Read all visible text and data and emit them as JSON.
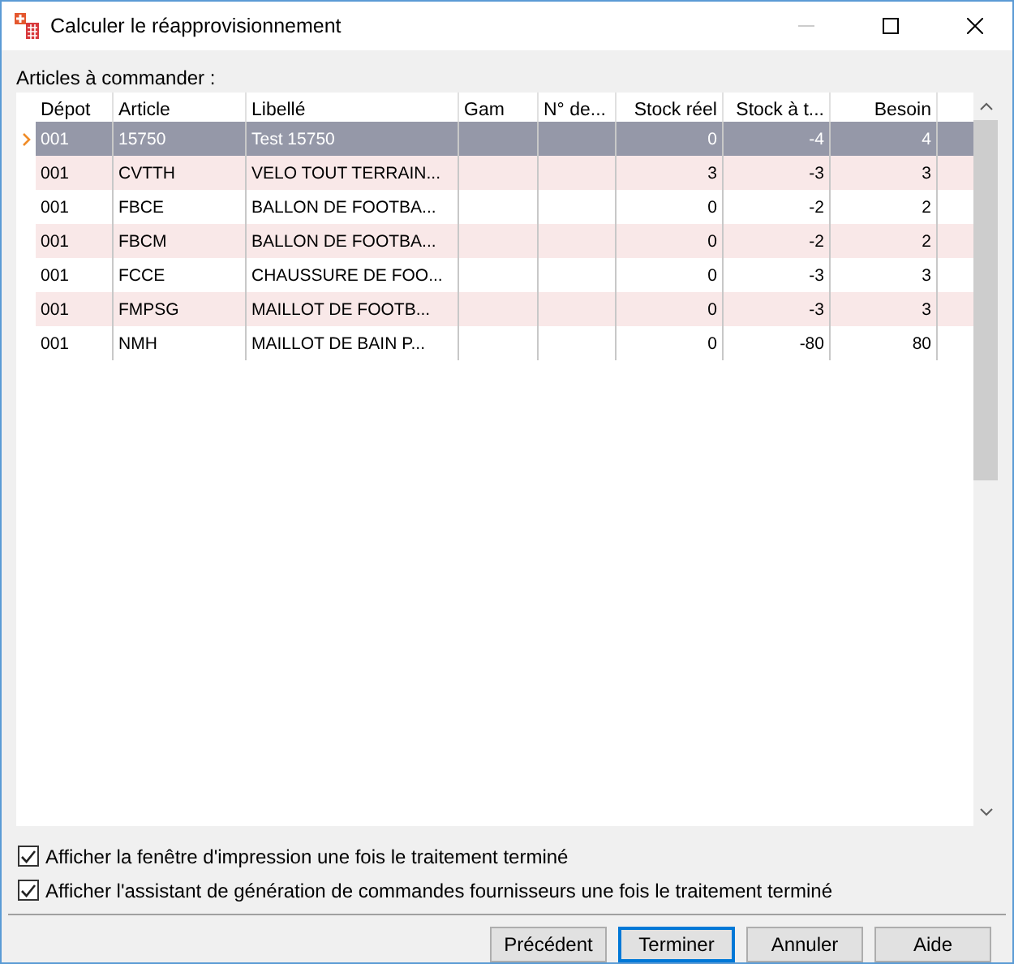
{
  "window": {
    "title": "Calculer le réapprovisionnement"
  },
  "grid_label": "Articles à commander :",
  "table": {
    "columns": [
      {
        "label": "Dépot",
        "kind": "text"
      },
      {
        "label": "Article",
        "kind": "text"
      },
      {
        "label": "Libellé",
        "kind": "text"
      },
      {
        "label": "Gam",
        "kind": "text"
      },
      {
        "label": "N° de...",
        "kind": "text"
      },
      {
        "label": "Stock réel",
        "kind": "number"
      },
      {
        "label": "Stock à t...",
        "kind": "number"
      },
      {
        "label": "Besoin",
        "kind": "number"
      }
    ],
    "rows": [
      {
        "selected": true,
        "cells": [
          "001",
          "15750",
          "Test 15750",
          "",
          "",
          "0",
          "-4",
          "4"
        ]
      },
      {
        "selected": false,
        "cells": [
          "001",
          "CVTTH",
          "VELO TOUT TERRAIN...",
          "",
          "",
          "3",
          "-3",
          "3"
        ]
      },
      {
        "selected": false,
        "cells": [
          "001",
          "FBCE",
          "BALLON DE FOOTBA...",
          "",
          "",
          "0",
          "-2",
          "2"
        ]
      },
      {
        "selected": false,
        "cells": [
          "001",
          "FBCM",
          "BALLON DE FOOTBA...",
          "",
          "",
          "0",
          "-2",
          "2"
        ]
      },
      {
        "selected": false,
        "cells": [
          "001",
          "FCCE",
          "CHAUSSURE DE FOO...",
          "",
          "",
          "0",
          "-3",
          "3"
        ]
      },
      {
        "selected": false,
        "cells": [
          "001",
          "FMPSG",
          "MAILLOT DE FOOTB...",
          "",
          "",
          "0",
          "-3",
          "3"
        ]
      },
      {
        "selected": false,
        "cells": [
          "001",
          "NMH",
          "MAILLOT DE BAIN P...",
          "",
          "",
          "0",
          "-80",
          "80"
        ]
      }
    ]
  },
  "options": [
    {
      "label": "Afficher la fenêtre d'impression une fois le traitement terminé",
      "checked": true
    },
    {
      "label": "Afficher l'assistant de génération de commandes fournisseurs une fois le traitement terminé",
      "checked": true
    }
  ],
  "buttons": [
    {
      "label": "Précédent",
      "default": false
    },
    {
      "label": "Terminer",
      "default": true
    },
    {
      "label": "Annuler",
      "default": false
    },
    {
      "label": "Aide",
      "default": false
    }
  ]
}
